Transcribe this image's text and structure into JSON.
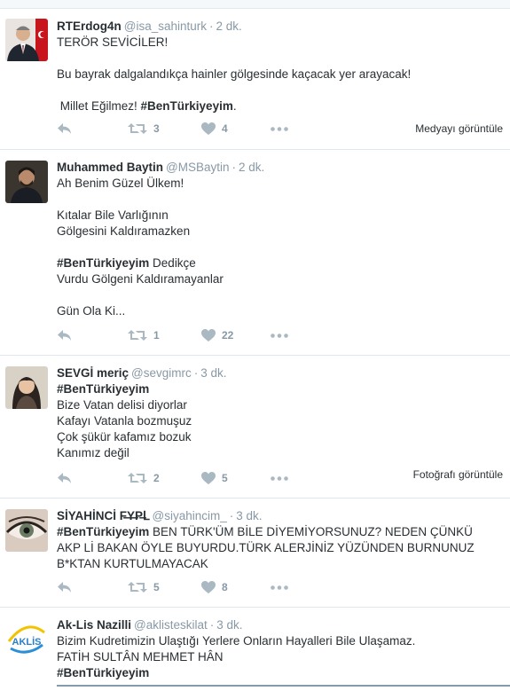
{
  "tweets": [
    {
      "name": "RTErdog4n",
      "handle": "@isa_sahinturk",
      "time": "2 dk.",
      "lines": [
        "TERÖR SEVİCİLER!",
        "",
        "Bu bayrak dalgalandıkça hainler gölgesinde kaçacak yer arayacak!",
        "",
        " Millet Eğilmez! "
      ],
      "tail_prefix": " Millet Eğilmez! ",
      "hashtag": "#BenTürkiyeyim",
      "tail_suffix": ".",
      "retweets": "3",
      "likes": "4",
      "media_link": "Medyayı görüntüle"
    },
    {
      "name": "Muhammed Baytin",
      "handle": "@MSBaytin",
      "time": "2 dk.",
      "line1": "Ah Benim Güzel Ülkem!",
      "line2": "Kıtalar Bile Varlığının",
      "line3": "Gölgesini Kaldıramazken",
      "hashtag": "#BenTürkiyeyim",
      "line4_suffix": " Dedikçe",
      "line5": "Vurdu Gölgeni Kaldıramayanlar",
      "line6": "Gün Ola Ki...",
      "retweets": "1",
      "likes": "22"
    },
    {
      "name": "SEVGİ meriç",
      "handle": "@sevgimrc",
      "time": "3 dk.",
      "hashtag": "#BenTürkiyeyim",
      "line1": "Bize Vatan delisi diyorlar",
      "line2": "Kafayı Vatanla bozmuşuz",
      "line3": "Çok şükür kafamız bozuk",
      "line4": "Kanımız değil",
      "retweets": "2",
      "likes": "5",
      "media_link": "Fotoğrafı görüntüle"
    },
    {
      "name": "SİYAHİNCİ F̶Y̶P̶ᒪ",
      "handle": "@siyahincim_",
      "time": "3 dk.",
      "hashtag": "#BenTürkiyeyim",
      "line1_suffix": " BEN TÜRK'ÜM BİLE DİYEMİYORSUNUZ? NEDEN ÇÜNKÜ",
      "line2": "AKP Lİ BAKAN ÖYLE BUYURDU.TÜRK ALERJİNİZ YÜZÜNDEN BURNUNUZ",
      "line3": "B*KTAN KURTULMAYACAK",
      "retweets": "5",
      "likes": "8"
    },
    {
      "name": "Ak-Lis Nazilli",
      "handle": "@aklisteskilat",
      "time": "3 dk.",
      "line1": "Bizim Kudretimizin Ulaştığı Yerlere Onların Hayalleri Bile Ulaşamaz.",
      "line2": "FATİH SULTÂN MEHMET HÂN",
      "hashtag": "#BenTürkiyeyim",
      "avatar_text": "AKLİS"
    }
  ],
  "colors": {
    "muted": "#8899a6",
    "text": "#292f33",
    "border": "#e1e8ed"
  },
  "icons": [
    "reply-icon",
    "retweet-icon",
    "heart-icon",
    "more-icon"
  ]
}
